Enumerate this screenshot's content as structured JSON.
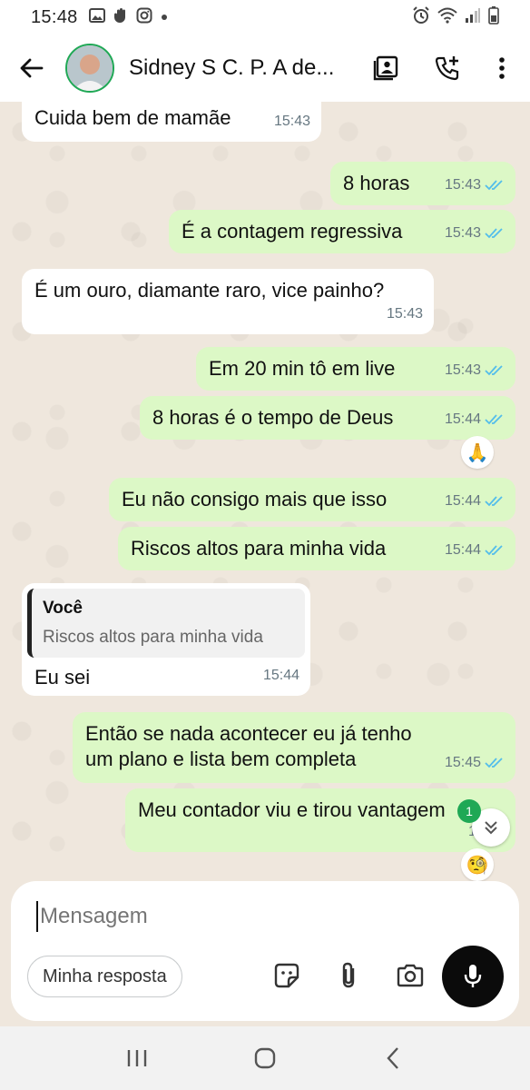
{
  "status_bar": {
    "time": "15:48",
    "left_icons": [
      "gallery-icon",
      "hand-icon",
      "instagram-icon",
      "dot-icon"
    ],
    "right_icons": [
      "alarm-icon",
      "wifi-icon",
      "signal-icon",
      "battery-icon"
    ]
  },
  "header": {
    "contact_name": "Sidney S C. P. A de...",
    "icons": [
      "back-arrow-icon",
      "contact-card-icon",
      "add-call-icon",
      "more-vert-icon"
    ]
  },
  "messages": [
    {
      "id": "m1",
      "direction": "in",
      "text": "Cuida bem de mamãe",
      "time": "15:43"
    },
    {
      "id": "m2",
      "direction": "out",
      "text": "8 horas",
      "time": "15:43",
      "read": true
    },
    {
      "id": "m3",
      "direction": "out",
      "text": "É a contagem regressiva",
      "time": "15:43",
      "read": true
    },
    {
      "id": "m4",
      "direction": "in",
      "text": "É um ouro, diamante raro, vice painho?",
      "time": "15:43"
    },
    {
      "id": "m5",
      "direction": "out",
      "text": "Em 20 min tô em live",
      "time": "15:43",
      "read": true
    },
    {
      "id": "m6",
      "direction": "out",
      "text": "8 horas é o tempo de Deus",
      "time": "15:44",
      "read": true,
      "reaction": "🙏"
    },
    {
      "id": "m7",
      "direction": "out",
      "text": "Eu não consigo mais que isso",
      "time": "15:44",
      "read": true
    },
    {
      "id": "m8",
      "direction": "out",
      "text": "Riscos altos para minha vida",
      "time": "15:44",
      "read": true
    },
    {
      "id": "m9",
      "direction": "in",
      "text": "Eu sei",
      "time": "15:44",
      "quote": {
        "author": "Você",
        "text": "Riscos altos para minha vida"
      }
    },
    {
      "id": "m10",
      "direction": "out",
      "text": "Então se nada acontecer eu já tenho\num plano e lista bem completa",
      "time": "15:45",
      "read": true
    },
    {
      "id": "m11",
      "direction": "out",
      "text": "Meu contador viu e tirou vantagem",
      "time": "15:45",
      "reaction": "🧐"
    }
  ],
  "scroll_down": {
    "unread_count": "1"
  },
  "composer": {
    "placeholder": "Mensagem",
    "reply_chip": "Minha resposta",
    "icons": [
      "sticker-icon",
      "attach-icon",
      "camera-icon",
      "mic-icon"
    ]
  },
  "nav_bar": {
    "icons": [
      "recents-icon",
      "home-icon",
      "back-icon"
    ]
  },
  "colors": {
    "outgoing": "#dcf8c6",
    "incoming": "#ffffff",
    "read_ticks": "#53bdeb",
    "accent": "#1fa855"
  }
}
